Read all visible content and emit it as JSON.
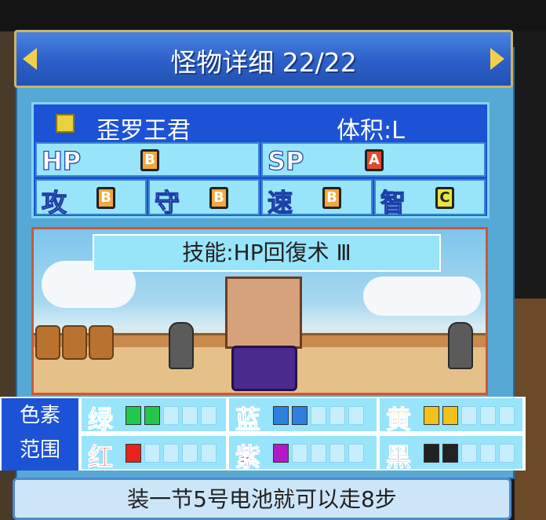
{
  "header": {
    "title": "怪物详细 22/22",
    "prev_icon": "arrow-left-icon",
    "next_icon": "arrow-right-icon"
  },
  "monster": {
    "name": "歪罗王君",
    "size": "体积:L"
  },
  "stats": [
    {
      "label": "HP",
      "grade": "B"
    },
    {
      "label": "SP",
      "grade": "A"
    },
    {
      "label": "攻",
      "grade": "B"
    },
    {
      "label": "守",
      "grade": "B"
    },
    {
      "label": "速",
      "grade": "B"
    },
    {
      "label": "智",
      "grade": "C"
    }
  ],
  "skill": "技能:HP回復术 Ⅲ",
  "pigment": {
    "header": [
      "色素",
      "范围"
    ],
    "colors": [
      {
        "name": "绿",
        "color": "#22c84a",
        "filled": 2
      },
      {
        "name": "蓝",
        "color": "#2f7fe0",
        "filled": 2
      },
      {
        "name": "黄",
        "color": "#f2c21a",
        "filled": 2
      },
      {
        "name": "红",
        "color": "#e8231e",
        "filled": 1
      },
      {
        "name": "紫",
        "color": "#b21ac8",
        "filled": 1
      },
      {
        "name": "黑",
        "color": "#222222",
        "filled": 2
      }
    ]
  },
  "footer": "装一节5号电池就可以走8步"
}
